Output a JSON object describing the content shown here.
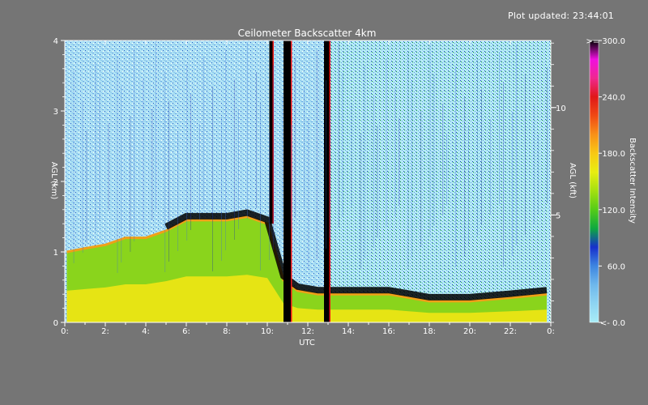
{
  "header": {
    "updated_label": "Plot updated: 23:44:01"
  },
  "chart_data": {
    "type": "heatmap",
    "title": "Ceilometer Backscatter 4km",
    "xlabel": "UTC",
    "ylabel_left": "AGL (km)",
    "ylabel_right": "AGL (kft)",
    "colorbar_label": "Backscatter Intensity",
    "xlim": [
      0,
      24
    ],
    "ylim_km": [
      0,
      4
    ],
    "ylim_kft": [
      0,
      13.12
    ],
    "x_ticks": [
      {
        "value": 0,
        "label": "0:"
      },
      {
        "value": 2,
        "label": "2:"
      },
      {
        "value": 4,
        "label": "4:"
      },
      {
        "value": 6,
        "label": "6:"
      },
      {
        "value": 8,
        "label": "8:"
      },
      {
        "value": 10,
        "label": "10:"
      },
      {
        "value": 12,
        "label": "12:"
      },
      {
        "value": 14,
        "label": "14:"
      },
      {
        "value": 16,
        "label": "16:"
      },
      {
        "value": 18,
        "label": "18:"
      },
      {
        "value": 20,
        "label": "20:"
      },
      {
        "value": 22,
        "label": "22:"
      },
      {
        "value": 24,
        "label": "0:"
      }
    ],
    "y_ticks_left": [
      {
        "value": 0,
        "label": "0"
      },
      {
        "value": 1,
        "label": "1"
      },
      {
        "value": 2,
        "label": "2"
      },
      {
        "value": 3,
        "label": "3"
      },
      {
        "value": 4,
        "label": "4"
      }
    ],
    "y_ticks_right": [
      {
        "value": 5,
        "label": "5"
      },
      {
        "value": 10,
        "label": "10"
      }
    ],
    "colorbar": {
      "range": [
        0,
        300
      ],
      "ticks": [
        {
          "value": 0,
          "label": "<-   0.0"
        },
        {
          "value": 60,
          "label": "60.0"
        },
        {
          "value": 120,
          "label": "120.0"
        },
        {
          "value": 180,
          "label": "180.0"
        },
        {
          "value": 240,
          "label": "240.0"
        },
        {
          "value": 300,
          "label": ">= 300.0"
        }
      ],
      "colors": [
        "#a8ecf6",
        "#8ed4f2",
        "#6fb8ec",
        "#3e86e0",
        "#1730cc",
        "#0ea840",
        "#55cc18",
        "#a4e010",
        "#e8ee10",
        "#f8c814",
        "#f89018",
        "#f04a14",
        "#e01818",
        "#f02890",
        "#f010e0",
        "#000000"
      ]
    },
    "boundary_layer_top_km": [
      {
        "x": 0.1,
        "y": 1.0
      },
      {
        "x": 1.0,
        "y": 1.05
      },
      {
        "x": 2.0,
        "y": 1.1
      },
      {
        "x": 3.0,
        "y": 1.2
      },
      {
        "x": 4.0,
        "y": 1.2
      },
      {
        "x": 5.0,
        "y": 1.3
      },
      {
        "x": 6.0,
        "y": 1.45
      },
      {
        "x": 7.0,
        "y": 1.45
      },
      {
        "x": 8.0,
        "y": 1.45
      },
      {
        "x": 9.0,
        "y": 1.5
      },
      {
        "x": 10.0,
        "y": 1.4
      },
      {
        "x": 10.8,
        "y": 0.6
      },
      {
        "x": 11.5,
        "y": 0.45
      },
      {
        "x": 12.5,
        "y": 0.4
      },
      {
        "x": 14.0,
        "y": 0.4
      },
      {
        "x": 16.0,
        "y": 0.4
      },
      {
        "x": 18.0,
        "y": 0.3
      },
      {
        "x": 20.0,
        "y": 0.3
      },
      {
        "x": 22.0,
        "y": 0.35
      },
      {
        "x": 23.8,
        "y": 0.4
      }
    ],
    "cloud_columns": [
      {
        "x_start": 10.1,
        "x_end": 10.3,
        "y_bottom": 1.4,
        "y_top": 4.0
      },
      {
        "x_start": 10.8,
        "x_end": 11.2,
        "y_bottom": 0.0,
        "y_top": 4.0
      },
      {
        "x_start": 12.8,
        "x_end": 13.1,
        "y_bottom": 0.0,
        "y_top": 4.0
      }
    ]
  }
}
